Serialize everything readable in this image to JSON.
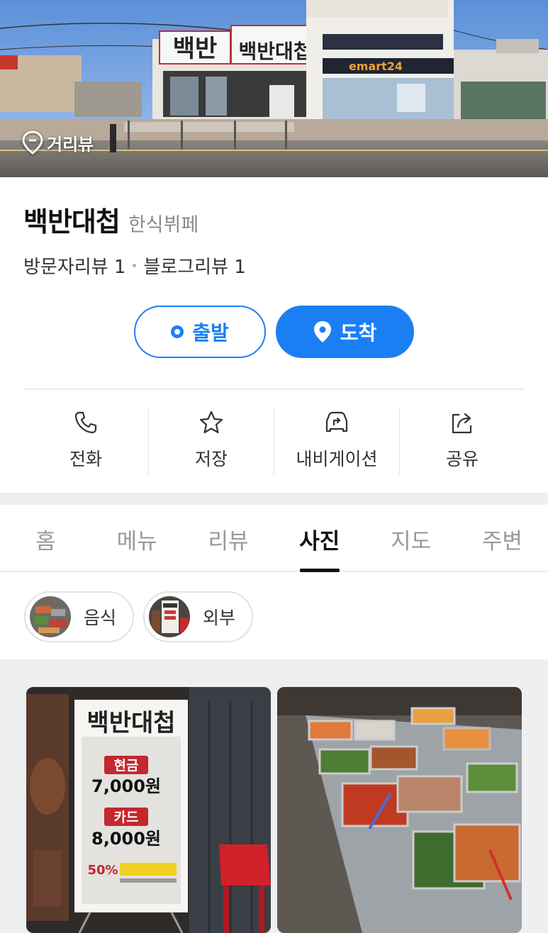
{
  "hero": {
    "street_view_label": "거리뷰",
    "sign_main": "백반대첩",
    "sign_short": "백반",
    "store_sign": "emart24"
  },
  "place": {
    "name": "백반대첩",
    "category": "한식뷔페"
  },
  "reviews": {
    "visitor": "방문자리뷰 1",
    "blog": "블로그리뷰 1"
  },
  "route": {
    "depart_label": "출발",
    "arrive_label": "도착"
  },
  "actions": [
    {
      "label": "전화",
      "icon": "phone-icon"
    },
    {
      "label": "저장",
      "icon": "star-icon"
    },
    {
      "label": "내비게이션",
      "icon": "car-navigation-icon"
    },
    {
      "label": "공유",
      "icon": "share-icon"
    }
  ],
  "tabs": [
    {
      "label": "홈"
    },
    {
      "label": "메뉴"
    },
    {
      "label": "리뷰"
    },
    {
      "label": "사진",
      "active": true
    },
    {
      "label": "지도"
    },
    {
      "label": "주변"
    }
  ],
  "photo_categories": [
    {
      "label": "음식"
    },
    {
      "label": "외부"
    }
  ],
  "photos": {
    "banner": {
      "title": "백반대첩",
      "cash_label": "현금",
      "cash_price": "7,000원",
      "card_label": "카드",
      "card_price": "8,000원",
      "discount": "50%"
    }
  },
  "colors": {
    "accent": "#1b7ff4",
    "active_tab": "#111111",
    "inactive_tab": "#999999",
    "band": "#eeeff1"
  }
}
